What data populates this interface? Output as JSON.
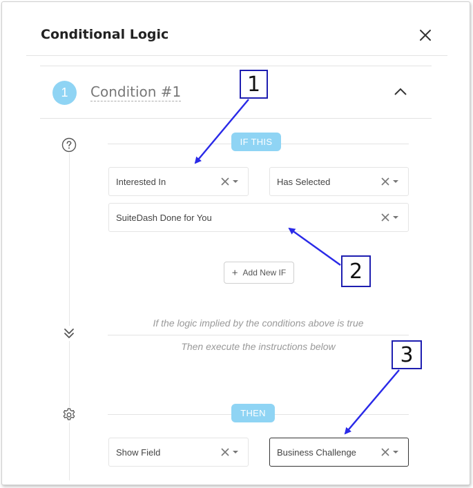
{
  "modal": {
    "title": "Conditional Logic"
  },
  "condition": {
    "number": "1",
    "title": "Condition #1"
  },
  "if_section": {
    "pill_label": "IF THIS",
    "field_select": "Interested In",
    "operator_select": "Has Selected",
    "value_select": "SuiteDash Done for You",
    "add_button_label": "Add New IF"
  },
  "logic_text": {
    "line1": "If the logic implied by the conditions above is true",
    "line2": "Then execute the instructions below"
  },
  "then_section": {
    "pill_label": "THEN",
    "action_select": "Show Field",
    "target_select": "Business Challenge"
  },
  "callouts": [
    "1",
    "2",
    "3"
  ],
  "colors": {
    "accent": "#8fd4f4",
    "annotation": "#1d1db0",
    "arrow": "#2a2ae8"
  },
  "icons": {
    "close": "close-icon",
    "collapse": "chevron-up-icon",
    "help": "question-circle-icon",
    "then_divider": "double-chevron-down-icon",
    "settings": "gear-icon",
    "clear": "clear-x-icon",
    "dropdown": "caret-down-icon",
    "add": "plus-icon"
  }
}
